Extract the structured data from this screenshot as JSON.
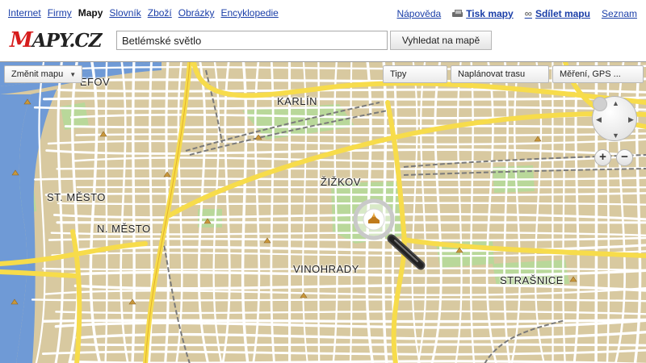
{
  "nav": {
    "links": [
      "Internet",
      "Firmy",
      "Mapy",
      "Slovník",
      "Zboží",
      "Obrázky",
      "Encyklopedie"
    ],
    "active": "Mapy",
    "right": {
      "help": "Nápověda",
      "print": "Tisk mapy",
      "share": "Sdílet mapu",
      "services": "Seznam"
    }
  },
  "logo": {
    "first": "M",
    "rest": "APY.CZ"
  },
  "search": {
    "value": "Betlémské světlo",
    "button": "Vyhledat na mapě"
  },
  "map_controls": {
    "change_map": "Změnit mapu",
    "tips": "Tipy",
    "plan_route": "Naplánovat trasu",
    "measure": "Měření, GPS ..."
  },
  "zoom": {
    "in": "+",
    "out": "−"
  },
  "pan": {
    "up": "▲",
    "down": "▼",
    "left": "◀",
    "right": "▶"
  },
  "districts": {
    "karlin": "KARLÍN",
    "zizkov": "ŽIŽKOV",
    "st_mesto": "ST. MĚSTO",
    "n_mesto": "N. MĚSTO",
    "vinohrady": "VINOHRADY",
    "strasnice": "STRAŠNICE",
    "josefov": "JOSEFOV"
  },
  "colors": {
    "land": "#d8c9a0",
    "street": "#ffffff",
    "main_road": "#f7dc4b",
    "river": "#6f9ad6",
    "park": "#b9d89a",
    "rail": "#7a7a7a"
  }
}
